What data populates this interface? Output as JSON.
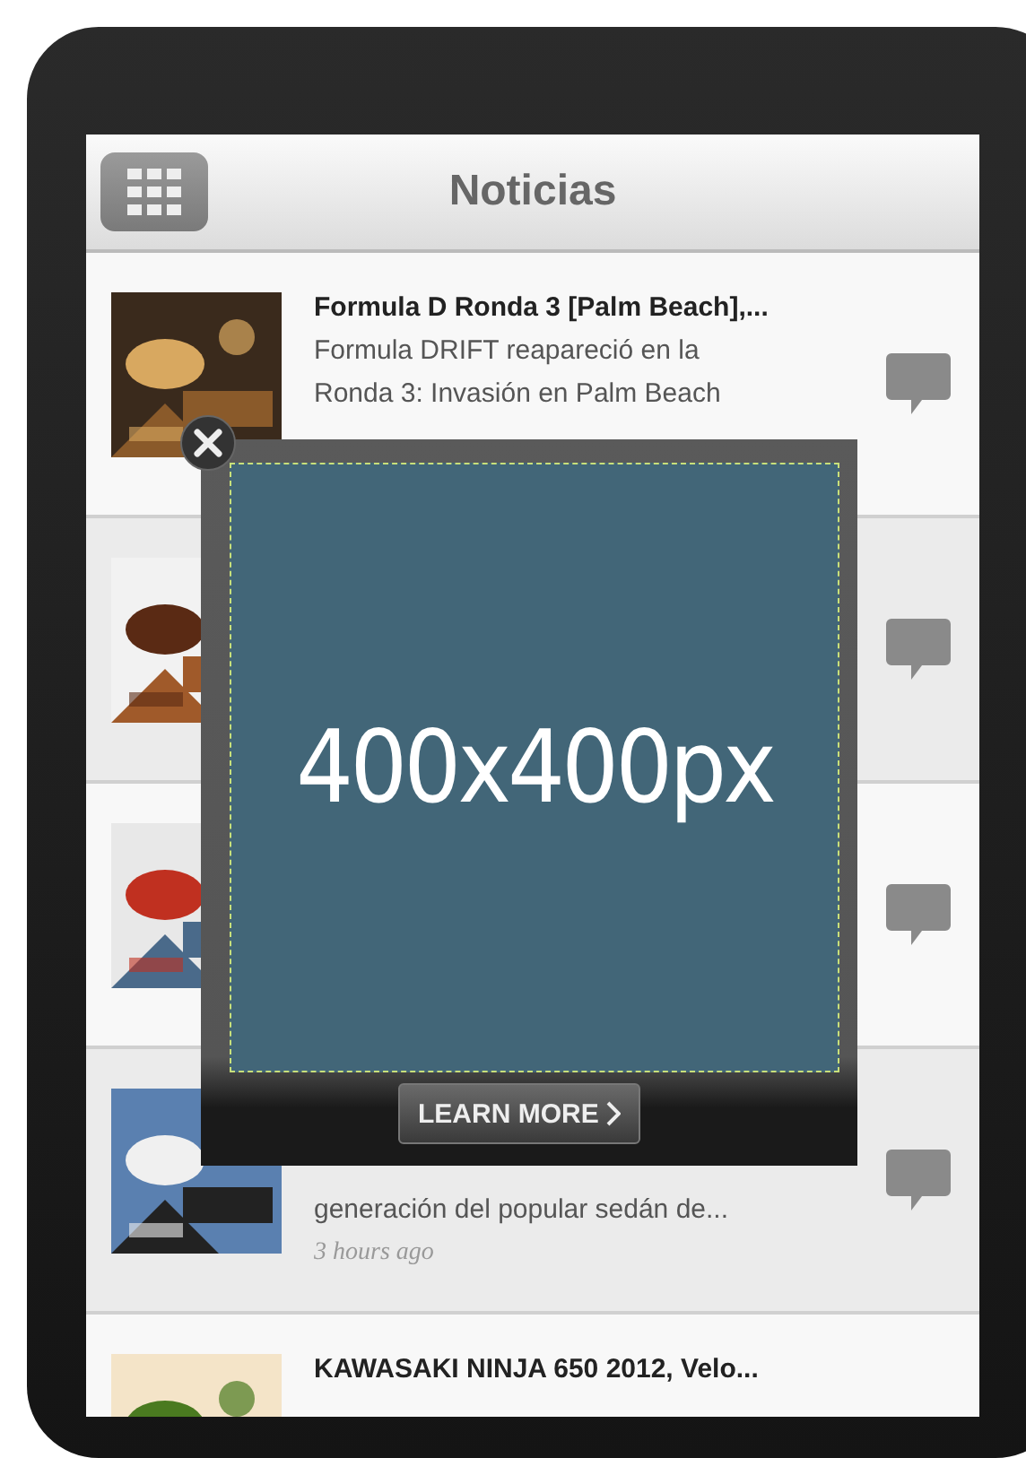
{
  "header": {
    "title": "Noticias"
  },
  "articles": [
    {
      "thumbnail": {
        "kind": "picture"
      },
      "title": "Formula D Ronda 3 [Palm Beach],...",
      "summary": "Formula DRIFT reapareció en la Ronda 3: Invasión en Palm Beach"
    },
    {
      "thumbnail": {
        "kind": "picture"
      }
    },
    {
      "thumbnail": {
        "kind": "picture"
      }
    },
    {
      "thumbnail": {
        "kind": "picture"
      },
      "summary": "generación del popular sedán de...",
      "time": "3 hours ago"
    },
    {
      "thumbnail": {
        "kind": "picture"
      },
      "title": "KAWASAKI NINJA 650 2012, Velo..."
    }
  ],
  "ad": {
    "placeholder_label": "400x400px",
    "button": "LEARN MORE"
  }
}
